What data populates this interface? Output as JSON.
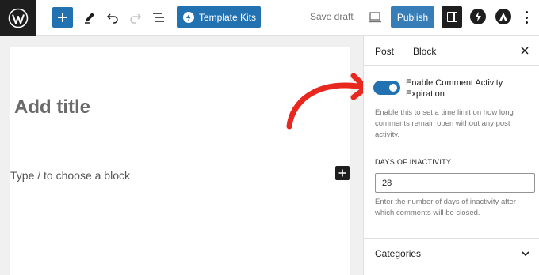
{
  "toolbar": {
    "template_kits_label": "Template Kits",
    "save_draft_label": "Save draft",
    "publish_label": "Publish"
  },
  "editor": {
    "title_placeholder": "Add title",
    "block_hint": "Type / to choose a block"
  },
  "sidebar": {
    "tabs": [
      {
        "label": "Post",
        "active": true
      },
      {
        "label": "Block",
        "active": false
      }
    ],
    "comment_expiration": {
      "toggle_label": "Enable Comment Activity Expiration",
      "toggle_on": true,
      "help": "Enable this to set a time limit on how long comments remain open without any post activity.",
      "days_label": "DAYS OF INACTIVITY",
      "days_value": "28",
      "days_help": "Enter the number of days of inactivity after which comments will be closed."
    },
    "categories_label": "Categories"
  },
  "colors": {
    "accent": "#2271b1",
    "dark": "#1e1e1e",
    "arrow": "#e8271f"
  },
  "icons": [
    "wordpress-icon",
    "plus-icon",
    "pen-icon",
    "undo-icon",
    "redo-icon",
    "list-view-icon",
    "template-kits-icon",
    "desktop-preview-icon",
    "settings-panel-icon",
    "bolt-icon",
    "astra-icon",
    "more-options-icon",
    "close-icon",
    "chevron-down-icon"
  ]
}
